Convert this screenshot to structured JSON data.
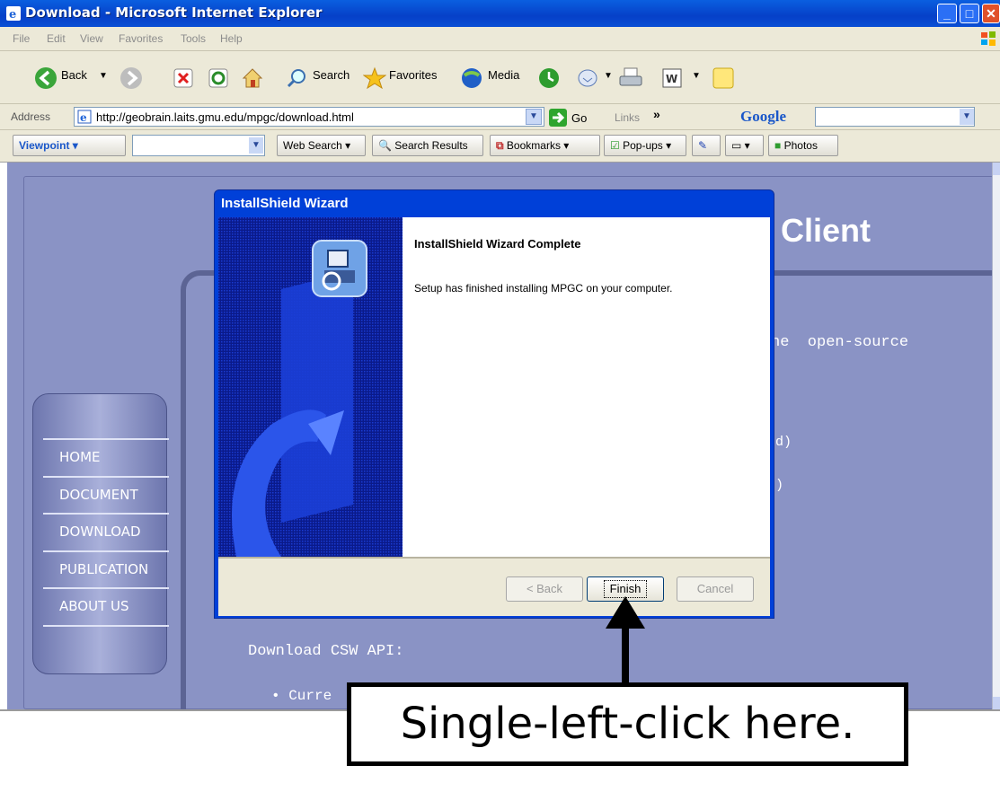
{
  "window": {
    "title": "Download - Microsoft Internet Explorer"
  },
  "menu": [
    "File",
    "Edit",
    "View",
    "Favorites",
    "Tools",
    "Help"
  ],
  "toolbar": {
    "back_label": "Back",
    "search_label": "Search",
    "favorites_label": "Favorites",
    "media_label": "Media"
  },
  "address": {
    "label": "Address",
    "url": "http://geobrain.laits.gmu.edu/mpgc/download.html",
    "go_label": "Go",
    "links_label": "Links",
    "google_label": "Google"
  },
  "viewpoint_bar": {
    "viewpoint_label": "Viewpoint",
    "web_search_label": "Web Search",
    "search_results_label": "Search Results",
    "bookmarks_label": "Bookmarks",
    "popups_label": "Pop-ups",
    "photos_label": "Photos"
  },
  "page": {
    "heading_fragment": "l Client",
    "text_open_source": "he  open-source",
    "paren_1": "d)",
    "paren_2": ")",
    "download_csw": "Download CSW API:",
    "bullet_text": "Curre",
    "nav": [
      "HOME",
      "DOCUMENT",
      "DOWNLOAD",
      "PUBLICATION",
      "ABOUT US"
    ]
  },
  "dialog": {
    "title": "InstallShield Wizard",
    "heading": "InstallShield Wizard Complete",
    "message": "Setup has finished installing MPGC on your computer.",
    "back_label": "< Back",
    "finish_label": "Finish",
    "cancel_label": "Cancel"
  },
  "annotation": {
    "callout": "Single-left-click here."
  },
  "colors": {
    "titlebar": "#0a5fe0",
    "dialog_frame": "#0040d8",
    "page_bg": "#8a93c5"
  }
}
